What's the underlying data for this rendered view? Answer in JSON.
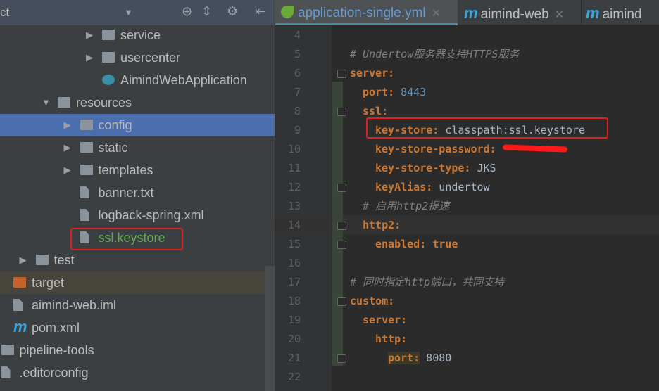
{
  "sidebar": {
    "title": "ct",
    "tree": [
      {
        "label": "service",
        "depth": 4,
        "icon": "folder-icon",
        "arrow": true
      },
      {
        "label": "usercenter",
        "depth": 4,
        "icon": "folder-icon",
        "arrow": true
      },
      {
        "label": "AimindWebApplication",
        "depth": 4,
        "icon": "spring-boot-class-icon",
        "arrow": false
      },
      {
        "label": "resources",
        "depth": 2,
        "icon": "resources-folder-icon",
        "arrow": true,
        "open": true
      },
      {
        "label": "config",
        "depth": 3,
        "icon": "folder-icon",
        "arrow": true,
        "selected": true
      },
      {
        "label": "static",
        "depth": 3,
        "icon": "folder-icon",
        "arrow": true
      },
      {
        "label": "templates",
        "depth": 3,
        "icon": "folder-icon",
        "arrow": true
      },
      {
        "label": "banner.txt",
        "depth": 3,
        "icon": "text-file-icon",
        "arrow": false
      },
      {
        "label": "logback-spring.xml",
        "depth": 3,
        "icon": "xml-file-icon",
        "arrow": false
      },
      {
        "label": "ssl.keystore",
        "depth": 3,
        "icon": "unknown-file-icon",
        "arrow": false,
        "color": "#62a857"
      },
      {
        "label": "test",
        "depth": 1,
        "icon": "folder-icon",
        "arrow": true
      },
      {
        "label": "target",
        "depth": 0,
        "icon": "excluded-folder-icon",
        "arrow": false,
        "excluded": true
      },
      {
        "label": "aimind-web.iml",
        "depth": 0,
        "icon": "iml-file-icon",
        "arrow": false
      },
      {
        "label": "pom.xml",
        "depth": 0,
        "icon": "maven-icon",
        "arrow": false
      },
      {
        "label": "pipeline-tools",
        "depth": -1,
        "icon": "folder-icon",
        "arrow": false
      },
      {
        "label": ".editorconfig",
        "depth": -1,
        "icon": "config-file-icon",
        "arrow": false
      }
    ]
  },
  "tabs": [
    {
      "label": "application-single.yml",
      "active": true
    },
    {
      "label": "aimind-web"
    },
    {
      "label": "aimind"
    }
  ],
  "editor": {
    "lines": [
      {
        "n": "4",
        "indent": 0,
        "tokens": []
      },
      {
        "n": "5",
        "indent": 0,
        "tokens": [
          {
            "t": "# Undertow服务器支持HTTPS服务",
            "k": "cmt"
          }
        ]
      },
      {
        "n": "6",
        "indent": 0,
        "tokens": [
          {
            "t": "server:",
            "k": "key"
          }
        ]
      },
      {
        "n": "7",
        "indent": 1,
        "tokens": [
          {
            "t": "port:",
            "k": "key"
          },
          {
            "t": " 8443",
            "k": "num"
          }
        ]
      },
      {
        "n": "8",
        "indent": 1,
        "tokens": [
          {
            "t": "ssl:",
            "k": "key"
          }
        ]
      },
      {
        "n": "9",
        "indent": 2,
        "tokens": [
          {
            "t": "key-store:",
            "k": "key"
          },
          {
            "t": " classpath:ssl.keystore",
            "k": "val"
          }
        ]
      },
      {
        "n": "10",
        "indent": 2,
        "tokens": [
          {
            "t": "key-store-password:",
            "k": "key"
          }
        ]
      },
      {
        "n": "11",
        "indent": 2,
        "tokens": [
          {
            "t": "key-store-type:",
            "k": "key"
          },
          {
            "t": " JKS",
            "k": "val"
          }
        ]
      },
      {
        "n": "12",
        "indent": 2,
        "tokens": [
          {
            "t": "keyAlias:",
            "k": "key"
          },
          {
            "t": " undertow",
            "k": "val"
          }
        ]
      },
      {
        "n": "13",
        "indent": 1,
        "tokens": [
          {
            "t": "# 启用http2提速",
            "k": "cmt"
          }
        ]
      },
      {
        "n": "14",
        "indent": 1,
        "tokens": [
          {
            "t": "http2:",
            "k": "key"
          }
        ]
      },
      {
        "n": "15",
        "indent": 2,
        "tokens": [
          {
            "t": "enabled:",
            "k": "key"
          },
          {
            "t": " true",
            "k": "kw"
          }
        ]
      },
      {
        "n": "16",
        "indent": 0,
        "tokens": []
      },
      {
        "n": "17",
        "indent": 0,
        "tokens": [
          {
            "t": "# 同时指定http端口，共同支持",
            "k": "cmt"
          }
        ]
      },
      {
        "n": "18",
        "indent": 0,
        "tokens": [
          {
            "t": "custom:",
            "k": "key"
          }
        ]
      },
      {
        "n": "19",
        "indent": 1,
        "tokens": [
          {
            "t": "server:",
            "k": "key"
          }
        ]
      },
      {
        "n": "20",
        "indent": 2,
        "tokens": [
          {
            "t": "http:",
            "k": "key"
          }
        ]
      },
      {
        "n": "21",
        "indent": 3,
        "tokens": [
          {
            "t": "port:",
            "k": "key",
            "bg": true
          },
          {
            "t": " 8080",
            "k": "val"
          }
        ]
      },
      {
        "n": "22",
        "indent": 0,
        "tokens": []
      }
    ]
  }
}
